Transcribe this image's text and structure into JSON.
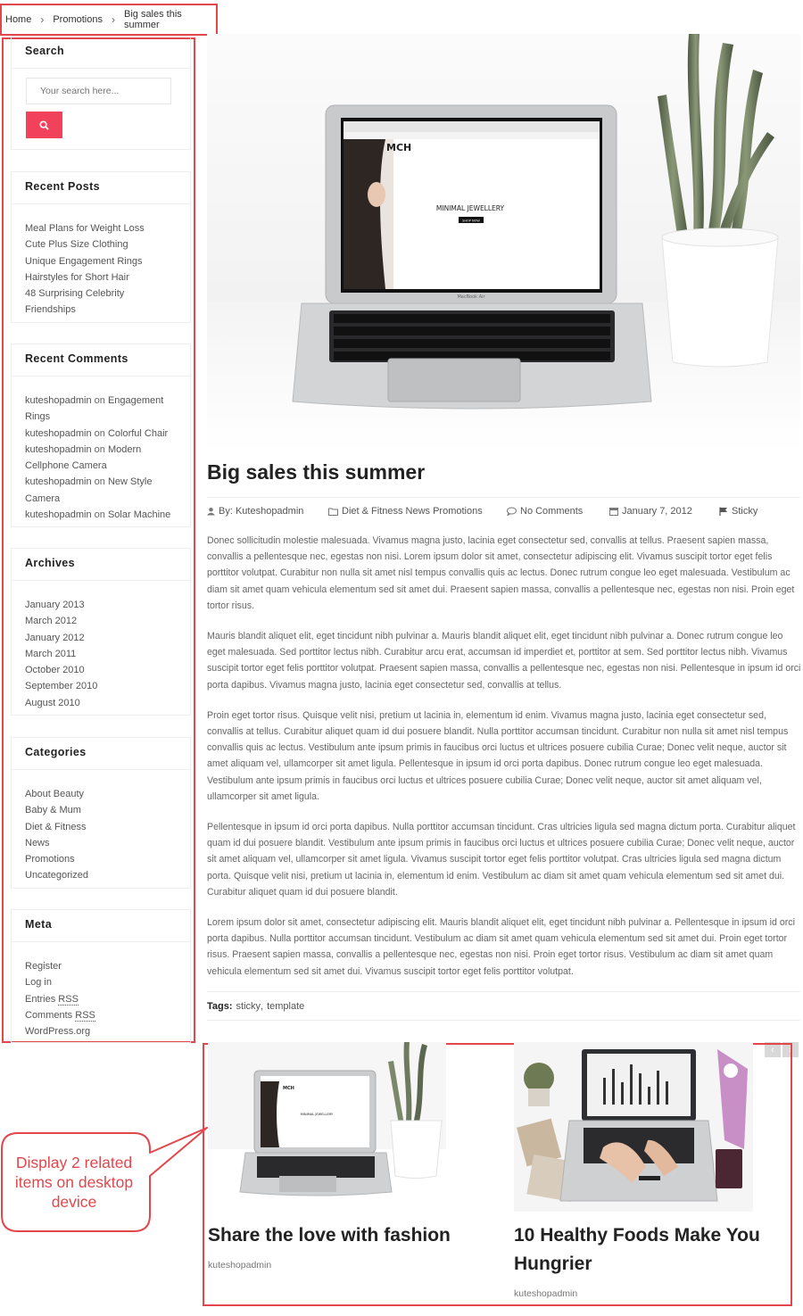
{
  "colors": {
    "annotation": "#e2474c",
    "accent": "#f2415b"
  },
  "breadcrumb": {
    "home": "Home",
    "category": "Promotions",
    "current": "Big sales this summer"
  },
  "sidebar": {
    "search": {
      "title": "Search",
      "placeholder": "Your search here...",
      "button_icon": "search-icon"
    },
    "recent_posts": {
      "title": "Recent Posts",
      "items": [
        "Meal Plans for Weight Loss",
        "Cute Plus Size Clothing",
        "Unique Engagement Rings",
        "Hairstyles for Short Hair",
        "48 Surprising Celebrity",
        "Friendships"
      ]
    },
    "recent_comments": {
      "title": "Recent Comments",
      "lines": [
        {
          "author": "kuteshopadmin",
          "on": " on ",
          "post": "Engagement"
        },
        {
          "post": "Rings"
        },
        {
          "author": "kuteshopadmin",
          "on": " on ",
          "post": "Colorful Chair"
        },
        {
          "author": "kuteshopadmin",
          "on": " on ",
          "post": "Modern"
        },
        {
          "post": "Cellphone Camera"
        },
        {
          "author": "kuteshopadmin",
          "on": " on ",
          "post": "New Style"
        },
        {
          "post": "Camera"
        },
        {
          "author": "kuteshopadmin",
          "on": " on ",
          "post": "Solar Machine"
        }
      ]
    },
    "archives": {
      "title": "Archives",
      "items": [
        "January 2013",
        "March 2012",
        "January 2012",
        "March 2011",
        "October 2010",
        "September 2010",
        "August 2010"
      ]
    },
    "categories": {
      "title": "Categories",
      "items": [
        "About Beauty",
        "Baby & Mum",
        "Diet & Fitness",
        "News",
        "Promotions",
        "Uncategorized"
      ]
    },
    "meta": {
      "title": "Meta",
      "register": "Register",
      "login": "Log in",
      "entries": "Entries ",
      "comments": "Comments ",
      "rss": "RSS",
      "wordpress": "WordPress.org"
    }
  },
  "hero": {
    "screen_brand": "MCH",
    "screen_headline": "MINIMAL JEWELLERY",
    "screen_button": "SHOP NOW",
    "laptop_label": "MacBook Air"
  },
  "post": {
    "title": "Big sales this summer",
    "meta": {
      "author": "By: Kuteshopadmin",
      "categories": "Diet & Fitness News Promotions",
      "comments": "No Comments",
      "date": "January 7, 2012",
      "sticky": "Sticky"
    },
    "paragraphs": [
      "Donec sollicitudin molestie malesuada. Vivamus magna justo, lacinia eget consectetur sed, convallis at tellus. Praesent sapien massa, convallis a pellentesque nec, egestas non nisi. Lorem ipsum dolor sit amet, consectetur adipiscing elit. Vivamus suscipit tortor eget felis porttitor volutpat. Curabitur non nulla sit amet nisl tempus convallis quis ac lectus. Donec rutrum congue leo eget malesuada. Vestibulum ac diam sit amet quam vehicula elementum sed sit amet dui. Praesent sapien massa, convallis a pellentesque nec, egestas non nisi. Proin eget tortor risus.",
      "Mauris blandit aliquet elit, eget tincidunt nibh pulvinar a. Mauris blandit aliquet elit, eget tincidunt nibh pulvinar a. Donec rutrum congue leo eget malesuada. Sed porttitor lectus nibh. Curabitur arcu erat, accumsan id imperdiet et, porttitor at sem. Sed porttitor lectus nibh. Vivamus suscipit tortor eget felis porttitor volutpat. Praesent sapien massa, convallis a pellentesque nec, egestas non nisi. Pellentesque in ipsum id orci porta dapibus. Vivamus magna justo, lacinia eget consectetur sed, convallis at tellus.",
      "Proin eget tortor risus. Quisque velit nisi, pretium ut lacinia in, elementum id enim. Vivamus magna justo, lacinia eget consectetur sed, convallis at tellus. Curabitur aliquet quam id dui posuere blandit. Nulla porttitor accumsan tincidunt. Curabitur non nulla sit amet nisl tempus convallis quis ac lectus. Vestibulum ante ipsum primis in faucibus orci luctus et ultrices posuere cubilia Curae; Donec velit neque, auctor sit amet aliquam vel, ullamcorper sit amet ligula. Pellentesque in ipsum id orci porta dapibus. Donec rutrum congue leo eget malesuada. Vestibulum ante ipsum primis in faucibus orci luctus et ultrices posuere cubilia Curae; Donec velit neque, auctor sit amet aliquam vel, ullamcorper sit amet ligula.",
      "Pellentesque in ipsum id orci porta dapibus. Nulla porttitor accumsan tincidunt. Cras ultricies ligula sed magna dictum porta. Curabitur aliquet quam id dui posuere blandit. Vestibulum ante ipsum primis in faucibus orci luctus et ultrices posuere cubilia Curae; Donec velit neque, auctor sit amet aliquam vel, ullamcorper sit amet ligula. Vivamus suscipit tortor eget felis porttitor volutpat. Cras ultricies ligula sed magna dictum porta. Quisque velit nisi, pretium ut lacinia in, elementum id enim. Vestibulum ac diam sit amet quam vehicula elementum sed sit amet dui. Curabitur aliquet quam id dui posuere blandit.",
      "Lorem ipsum dolor sit amet, consectetur adipiscing elit. Mauris blandit aliquet elit, eget tincidunt nibh pulvinar a. Pellentesque in ipsum id orci porta dapibus. Nulla porttitor accumsan tincidunt. Vestibulum ac diam sit amet quam vehicula elementum sed sit amet dui. Proin eget tortor risus. Praesent sapien massa, convallis a pellentesque nec, egestas non nisi. Proin eget tortor risus. Vestibulum ac diam sit amet quam vehicula elementum sed sit amet dui. Vivamus suscipit tortor eget felis porttitor volutpat."
    ],
    "tags": {
      "label": "Tags:",
      "items": [
        "sticky",
        "template"
      ]
    }
  },
  "related": {
    "items": [
      {
        "title": "Share the love with fashion",
        "author": "kuteshopadmin"
      },
      {
        "title": "10 Healthy Foods Make You Hungrier",
        "author": "kuteshopadmin"
      }
    ],
    "prev_icon": "chevron-left-icon",
    "next_icon": "chevron-right-icon"
  },
  "annotation": {
    "text": "Display 2 related items on desktop device"
  }
}
